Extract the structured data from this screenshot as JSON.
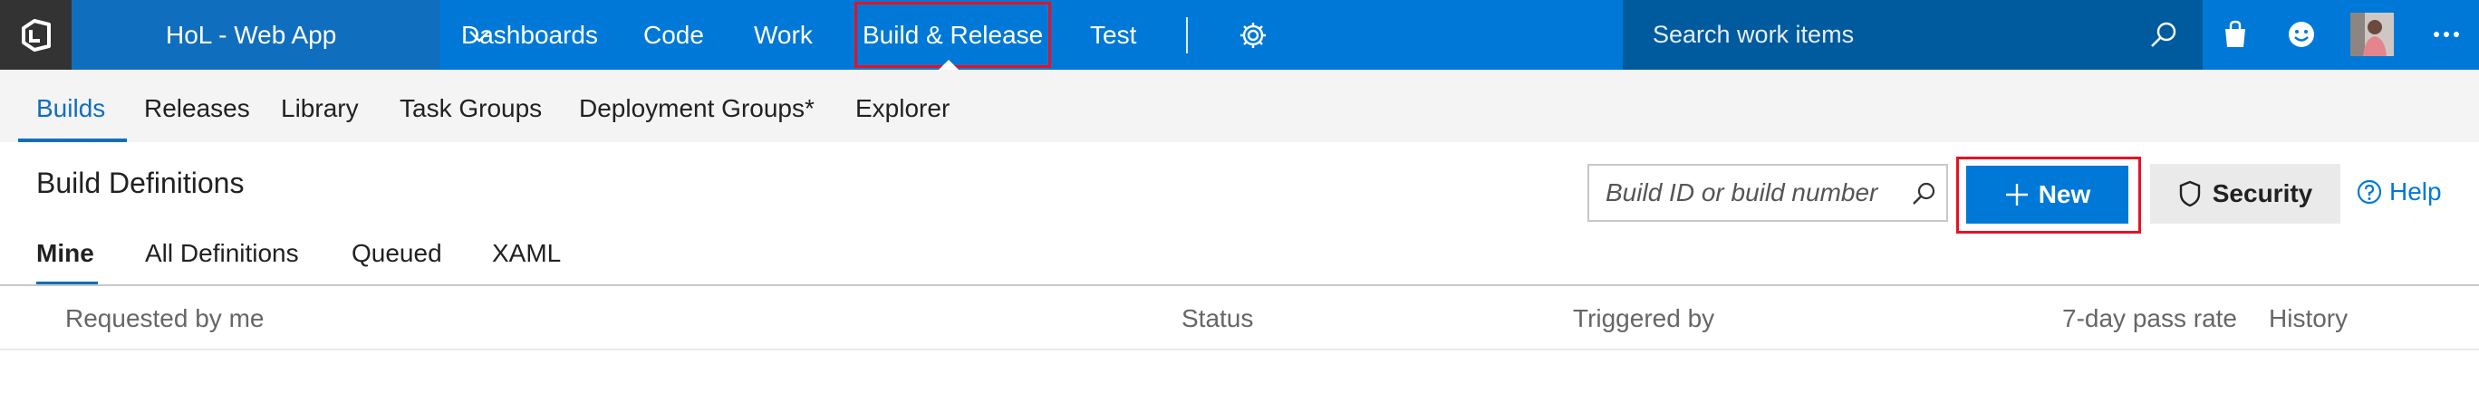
{
  "top_nav": {
    "project_name": "HoL - Web App",
    "items": [
      {
        "label": "Dashboards"
      },
      {
        "label": "Code"
      },
      {
        "label": "Work"
      },
      {
        "label": "Build & Release"
      },
      {
        "label": "Test"
      }
    ],
    "active_item": "Build & Release",
    "search_placeholder": "Search work items",
    "icons": [
      "vsts-logo-icon",
      "chevron-down-icon",
      "gear-icon",
      "search-icon",
      "marketplace-bag-icon",
      "smiley-feedback-icon",
      "avatar",
      "more-ellipsis-icon"
    ]
  },
  "sub_nav": {
    "items": [
      {
        "label": "Builds"
      },
      {
        "label": "Releases"
      },
      {
        "label": "Library"
      },
      {
        "label": "Task Groups"
      },
      {
        "label": "Deployment Groups*"
      },
      {
        "label": "Explorer"
      }
    ],
    "selected": "Builds"
  },
  "page": {
    "title": "Build Definitions",
    "pivots": [
      {
        "label": "Mine"
      },
      {
        "label": "All Definitions"
      },
      {
        "label": "Queued"
      },
      {
        "label": "XAML"
      }
    ],
    "selected_pivot": "Mine"
  },
  "toolbar": {
    "build_search_placeholder": "Build ID or build number",
    "new_label": "New",
    "security_label": "Security",
    "help_label": "Help"
  },
  "grid": {
    "columns": [
      {
        "label": "Requested by me"
      },
      {
        "label": "Status"
      },
      {
        "label": "Triggered by"
      },
      {
        "label": "7-day pass rate"
      },
      {
        "label": "History"
      }
    ]
  },
  "colors": {
    "brand_blue": "#0078d7",
    "project_blue": "#106ebe",
    "search_blue": "#005a9e",
    "logo_dark": "#333333",
    "highlight_red": "#e81123",
    "subnav_bg": "#f4f4f4"
  }
}
